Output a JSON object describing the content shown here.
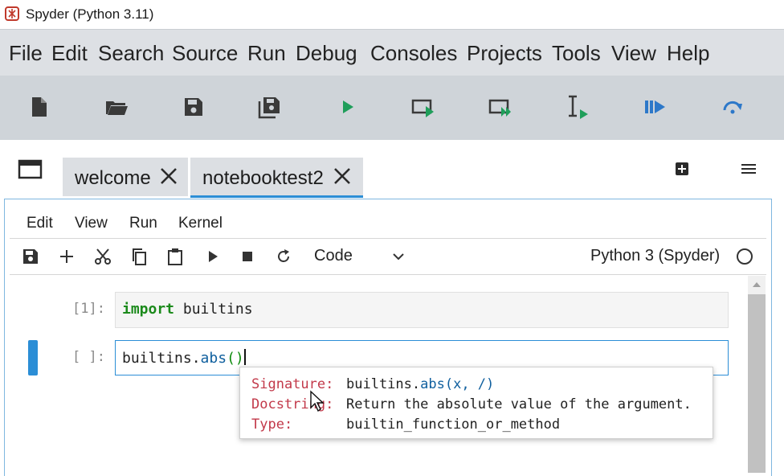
{
  "window": {
    "title": "Spyder (Python 3.11)"
  },
  "menubar": [
    "File",
    "Edit",
    "Search",
    "Source",
    "Run",
    "Debug",
    "Consoles",
    "Projects",
    "Tools",
    "View",
    "Help"
  ],
  "toolbar": [
    "new-file-icon",
    "open-folder-icon",
    "save-icon",
    "save-all-icon",
    "run-icon",
    "run-cell-icon",
    "run-cell-advance-icon",
    "run-selection-icon",
    "debug-icon",
    "step-over-icon"
  ],
  "tabs": [
    {
      "label": "welcome",
      "active": false
    },
    {
      "label": "notebooktest2",
      "active": true
    }
  ],
  "notebook": {
    "menu": [
      "Edit",
      "View",
      "Run",
      "Kernel"
    ],
    "cell_type": "Code",
    "kernel": "Python 3 (Spyder)"
  },
  "cells": [
    {
      "prompt": "[1]:",
      "keyword": "import",
      "rest": " builtins"
    },
    {
      "prompt": "[ ]:",
      "module": "builtins.",
      "func": "abs",
      "parens": "()"
    }
  ],
  "tooltip": {
    "signature_label": "Signature:",
    "signature_module": "builtins.",
    "signature_func": "abs",
    "signature_args": "(x, /)",
    "docstring_label": "Docstring:",
    "docstring_value": "Return the absolute value of the argument.",
    "type_label": "Type:",
    "type_value": "builtin_function_or_method"
  },
  "colors": {
    "accent": "#2b8ed6",
    "run_green": "#1f9e5a",
    "keyword_green": "#1b8a1b",
    "tooltip_key": "#c2394a"
  }
}
